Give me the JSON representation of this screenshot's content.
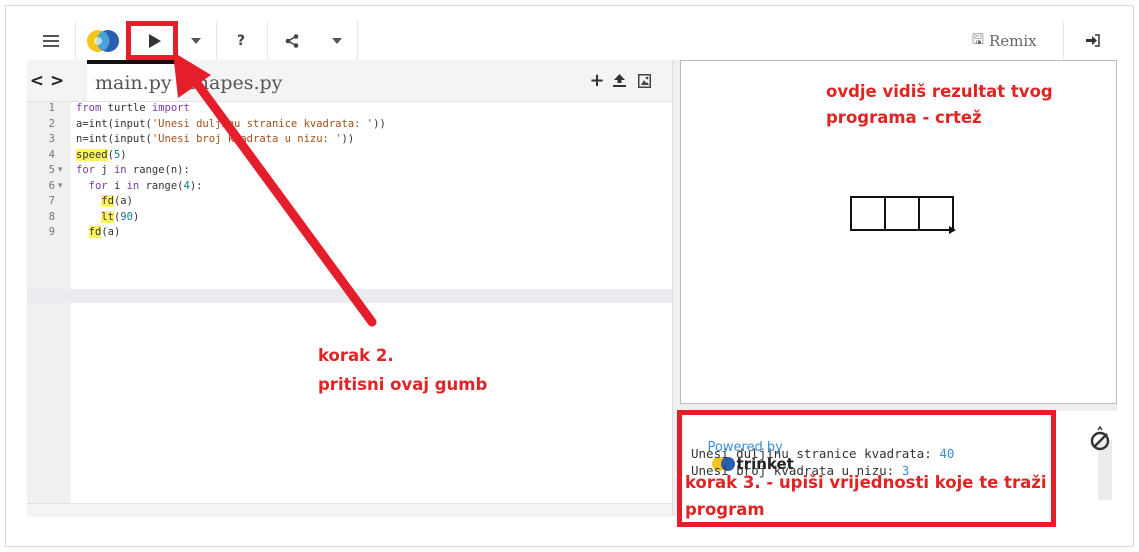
{
  "toolbar": {
    "menu_icon": "hamburger-menu-icon",
    "logo_icon": "trinket-logo-icon",
    "run_icon": "play-icon",
    "help_label": "?",
    "remix_label": "Remix",
    "login_icon": "sign-in-icon"
  },
  "editor": {
    "tabs": [
      "main.py",
      "shapes.py"
    ],
    "line_numbers": [
      "1",
      "2",
      "3",
      "4",
      "5",
      "6",
      "7",
      "8",
      "9"
    ],
    "code_lines": [
      "from turtle import",
      "a=int(input('Unesi duljinu stranice kvadrata: '))",
      "n=int(input('Unesi broj kvadrata u nizu: '))",
      "speed(5)",
      "for j in range(n):",
      "  for i in range(4):",
      "    fd(a)",
      "    lt(90)",
      "  fd(a)"
    ]
  },
  "console": {
    "powered_by": "Powered by",
    "brand": "trinket",
    "line1_prompt": "Unesi duljinu stranice kvadrata: ",
    "line1_value": "40",
    "line2_prompt": "Unesi broj kvadrata u nizu: ",
    "line2_value": "3"
  },
  "annotations": {
    "output_line1": "ovdje vidiš rezultat tvog",
    "output_line2": "programa - crtež",
    "step2_line1": "korak 2.",
    "step2_line2": "pritisni ovaj gumb",
    "step3_line1": "korak 3. - upiši vrijednosti koje te traži",
    "step3_line2": "program"
  },
  "colors": {
    "annotation_red": "#e41e2b"
  }
}
